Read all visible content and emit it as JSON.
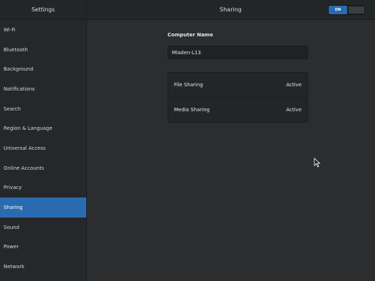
{
  "window": {
    "sidebar_title": "Settings",
    "panel_title": "Sharing",
    "toggle_label": "ON"
  },
  "sidebar": {
    "items": [
      {
        "label": "Wi-Fi"
      },
      {
        "label": "Bluetooth"
      },
      {
        "label": "Background"
      },
      {
        "label": "Notifications"
      },
      {
        "label": "Search"
      },
      {
        "label": "Region & Language"
      },
      {
        "label": "Universal Access"
      },
      {
        "label": "Online Accounts"
      },
      {
        "label": "Privacy"
      },
      {
        "label": "Sharing"
      },
      {
        "label": "Sound"
      },
      {
        "label": "Power"
      },
      {
        "label": "Network"
      }
    ],
    "selected": "Sharing"
  },
  "main": {
    "computer_name_label": "Computer Name",
    "computer_name_value": "Mladen-L13",
    "services": [
      {
        "name": "File Sharing",
        "status": "Active"
      },
      {
        "name": "Media Sharing",
        "status": "Active"
      }
    ]
  },
  "colors": {
    "accent": "#2a6bb0",
    "background": "#2b2d2e",
    "sidebar": "#25282a"
  }
}
